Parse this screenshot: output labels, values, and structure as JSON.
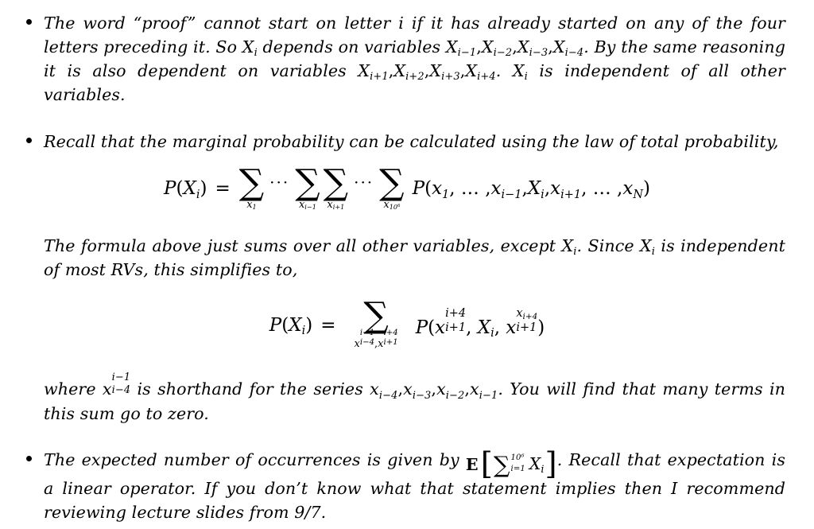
{
  "document": {
    "type": "lecture-notes-solution",
    "bullets": [
      {
        "id": "independence-structure",
        "segments": [
          {
            "t": "text",
            "v": "The word “proof” cannot start on letter "
          },
          {
            "t": "math",
            "v": "i"
          },
          {
            "t": "text",
            "v": " if it has already started on any of the four letters preceding it. So "
          },
          {
            "t": "math",
            "v": "X_i"
          },
          {
            "t": "text",
            "v": " depends on variables "
          },
          {
            "t": "math",
            "v": "X_{i-1}, X_{i-2}, X_{i-3}, X_{i-4}"
          },
          {
            "t": "text",
            "v": ". By the same reasoning it is also dependent on variables "
          },
          {
            "t": "math",
            "v": "X_{i+1}, X_{i+2}, X_{i+3}, X_{i+4}"
          },
          {
            "t": "text",
            "v": ". "
          },
          {
            "t": "math",
            "v": "X_i"
          },
          {
            "t": "text",
            "v": " is independent of all other variables."
          }
        ]
      },
      {
        "id": "marginal-law-of-total-probability",
        "segments": [
          {
            "t": "text",
            "v": "Recall that the marginal probability can be calculated using the law of total probability,"
          }
        ]
      },
      {
        "id": "expectation-linearity",
        "segments": [
          {
            "t": "text",
            "v": "The expected number of occurrences is given by "
          },
          {
            "t": "math",
            "v": "E[ sum_{i=1}^{10^6} X_i ]"
          },
          {
            "t": "text",
            "v": ". Recall that expectation is a linear operator. If you don’t know what that statement implies then I recommend reviewing lecture slides from 9/7."
          }
        ]
      }
    ],
    "bullet1_text": "The word “proof” cannot start on letter",
    "bullet1_text_b": "if it has already started on any of the four letters preceding it. So",
    "bullet1_text_c": "depends on variables",
    "bullet1_text_d": ". By the same reasoning it is also dependent on variables",
    "bullet1_text_e": ".",
    "bullet1_text_f": "is independent of all other variables.",
    "bullet2_text": "Recall that the marginal probability can be calculated using the law of total probability,",
    "paragraph1_a": "The formula above just sums over all other variables, except",
    "paragraph1_b": ". Since",
    "paragraph1_c": "is independent of most RVs, this simplifies to,",
    "paragraph2_a": "where",
    "paragraph2_b": "is shorthand for the series",
    "paragraph2_c": ". You will find that many terms in this sum go to zero.",
    "bullet3_a": "The expected number of occurrences is given by",
    "bullet3_b": ". Recall that expectation is a linear operator. If you don’t know what that statement implies then I recommend reviewing lecture slides from 9/7."
  },
  "math": {
    "i": "i",
    "X": "X",
    "x": "x",
    "P": "P",
    "N": "N",
    "E": "E",
    "equals": "=",
    "dots": "···",
    "sigma": "∑",
    "comma": ",",
    "period": ".",
    "lparen": "(",
    "rparen": ")",
    "lbracket": "[",
    "rbracket": "]",
    "sub_i": "i",
    "sub_i_minus_1": "i−1",
    "sub_i_minus_2": "i−2",
    "sub_i_minus_3": "i−3",
    "sub_i_minus_4": "i−4",
    "sub_i_plus_1": "i+1",
    "sub_i_plus_2": "i+2",
    "sub_i_plus_3": "i+3",
    "sub_i_plus_4": "i+4",
    "sub_1": "1",
    "sub_N": "N",
    "ten": "10",
    "six": "6",
    "one": "1",
    "i_equals_1": "i=1",
    "ten_to_six": "10⁶"
  },
  "equation1": {
    "id": "law-of-total-probability",
    "lhs_P": "P",
    "lhs_open": "(",
    "lhs_X": "X",
    "lhs_sub": "i",
    "lhs_close": ")",
    "relation": "=",
    "sum1_limit_var": "x",
    "sum1_limit_sub": "1",
    "dots1": "···",
    "sum2_limit_var": "x",
    "sum2_limit_sub": "i−1",
    "sum3_limit_var": "x",
    "sum3_limit_sub": "i+1",
    "dots2": "···",
    "sum4_limit_var": "x",
    "sum4_limit_sub_base": "10",
    "sum4_limit_sub_exp": "6",
    "rhs_P": "P",
    "rhs_open": "(",
    "rhs_a_var": "x",
    "rhs_a_sub": "1",
    "rhs_dots1": ", … ,",
    "rhs_b_var": "x",
    "rhs_b_sub": "i−1",
    "rhs_c_var": "X",
    "rhs_c_sub": "i",
    "rhs_d_var": "x",
    "rhs_d_sub": "i+1",
    "rhs_dots2": ", … ,",
    "rhs_e_var": "x",
    "rhs_e_sub": "N",
    "rhs_close": ")",
    "latex": "P(X_i) = \\sum_{x_1}\\cdots\\sum_{x_{i-1}}\\sum_{x_{i+1}}\\cdots\\sum_{x_{10^6}} P(x_1,\\ldots,x_{i-1},X_i,x_{i+1},\\ldots,x_N)"
  },
  "equation2": {
    "id": "simplified-marginal",
    "lhs_P": "P",
    "lhs_open": "(",
    "lhs_X": "X",
    "lhs_sub": "i",
    "lhs_close": ")",
    "relation": "=",
    "sum_limit_a_var": "x",
    "sum_limit_a_sup": "i−1",
    "sum_limit_a_sub": "i−4",
    "sum_limit_sep": ",",
    "sum_limit_b_var": "x",
    "sum_limit_b_sup": "i+4",
    "sum_limit_b_sub": "i+1",
    "rhs_P": "P",
    "rhs_open": "(",
    "arg1_var": "x",
    "arg1_sup": "i+4",
    "arg1_sub": "i+1",
    "arg2_var": "X",
    "arg2_sub": "i",
    "arg3_var": "x",
    "arg3_sup_var": "x",
    "arg3_sup_sub": "i+4",
    "arg3_sub": "i+1",
    "rhs_close": ")",
    "comma": ",",
    "latex": "P(X_i) = \\sum_{x_{i-4}^{i-1},x_{i+1}^{i+4}} P(x_{i+1}^{i+4}, X_i, x_{i+1}^{x_{i+4}})"
  },
  "equation3": {
    "id": "expectation-sum",
    "E": "E",
    "lbracket": "[",
    "sigma": "∑",
    "upper": "10⁶",
    "lower": "i=1",
    "body_var": "X",
    "body_sub": "i",
    "rbracket": "]",
    "latex": "\\mathbf{E}\\left[\\sum_{i=1}^{10^6} X_i\\right]"
  },
  "inline_math": {
    "shorthand_var": "x",
    "shorthand_sup": "i−1",
    "shorthand_sub": "i−4",
    "series": [
      "x_{i-4}",
      "x_{i-3}",
      "x_{i-2}",
      "x_{i-1}"
    ],
    "series_vars": [
      "x",
      "x",
      "x",
      "x"
    ],
    "series_subs": [
      "i−4",
      "i−3",
      "i−2",
      "i−1"
    ]
  },
  "colors": {
    "background": "#ffffff",
    "text": "#000000"
  }
}
